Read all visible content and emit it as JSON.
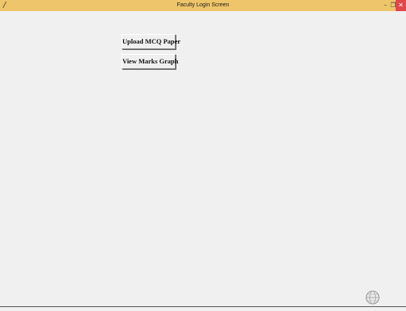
{
  "window": {
    "title": "Faculty Login Screen",
    "app_icon": "feather-icon",
    "controls": {
      "minimize": "–",
      "maximize": "❐",
      "close": "✕"
    },
    "titlebar_color": "#eec56a",
    "close_color": "#e0464b",
    "background_color": "#f0f0f0"
  },
  "buttons": {
    "upload_label": "Upload MCQ Paper",
    "graph_label": "View Marks Graph"
  },
  "taskbar": {
    "icon": "globe-icon"
  }
}
